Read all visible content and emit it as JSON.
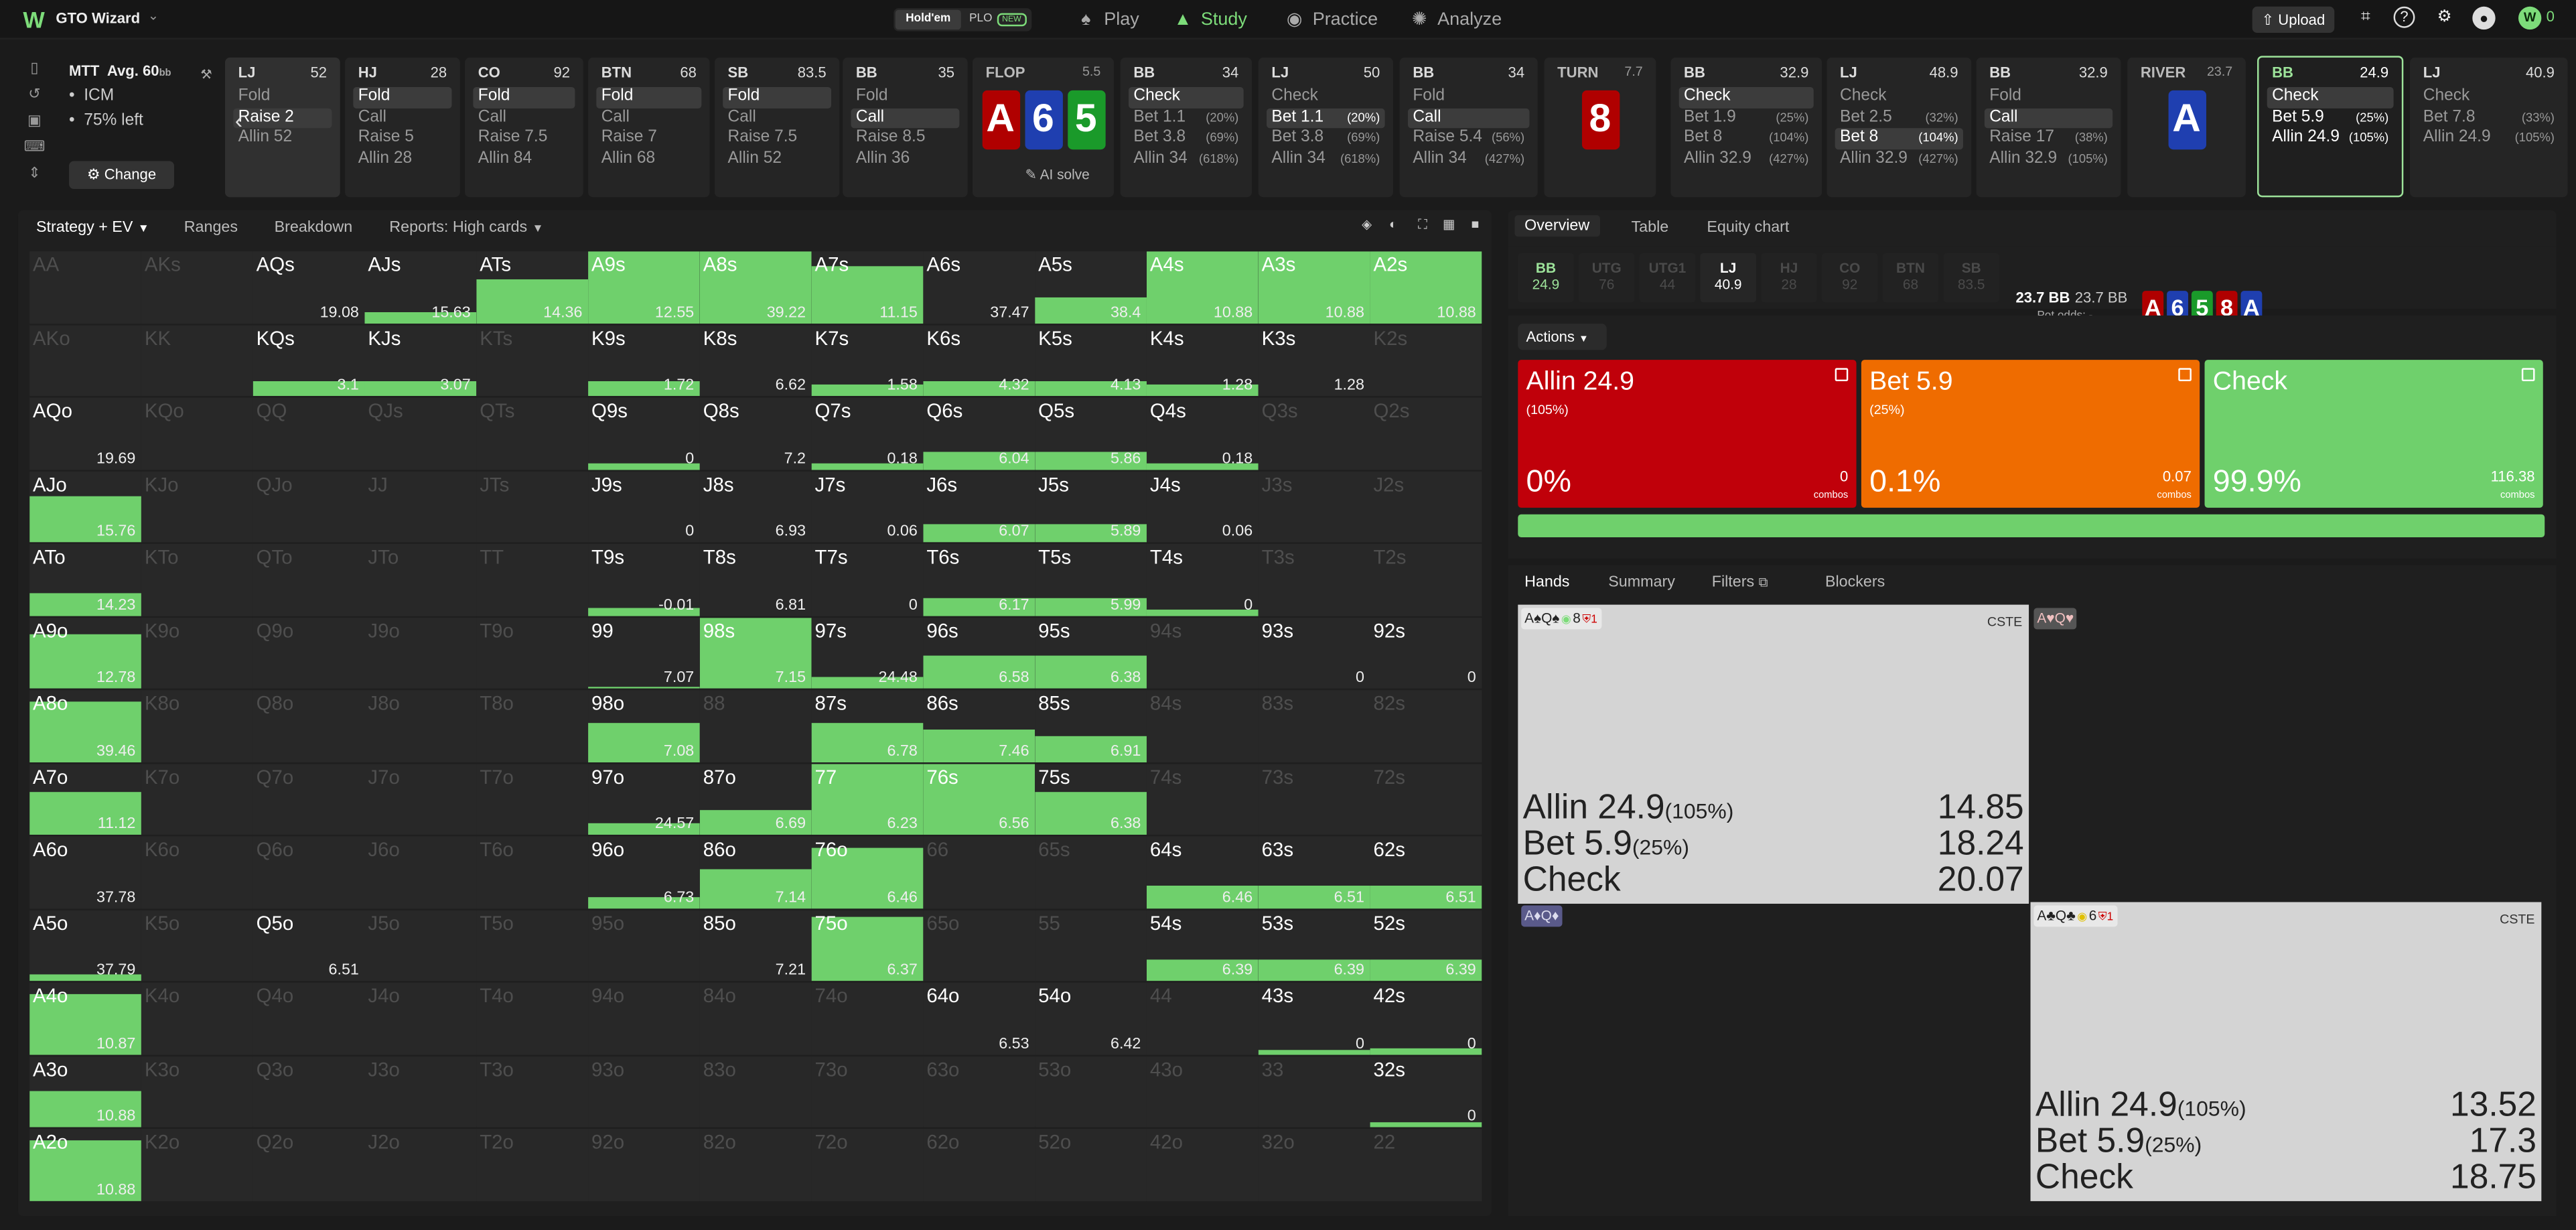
{
  "app": {
    "name": "GTO Wizard",
    "game_holdem": "Hold'em",
    "game_plo": "PLO",
    "game_new": "NEW"
  },
  "nav": [
    {
      "label": "Play",
      "icon": "spade-icon",
      "active": false
    },
    {
      "label": "Study",
      "icon": "graduation-cap-icon",
      "active": true
    },
    {
      "label": "Practice",
      "icon": "gamepad-icon",
      "active": false
    },
    {
      "label": "Analyze",
      "icon": "bulb-icon",
      "active": false
    }
  ],
  "topright": {
    "upload": "Upload",
    "badge_num": "0"
  },
  "mtt": {
    "title": "MTT",
    "avg": "Avg. 60",
    "avg_unit": "bb",
    "icm": "ICM",
    "left": "75% left",
    "change": "Change"
  },
  "positions": [
    {
      "name": "LJ",
      "stack": "52",
      "actions": [
        {
          "t": "Fold"
        },
        {
          "t": "Raise 2",
          "sel": true
        },
        {
          "t": "Allin 52"
        }
      ]
    },
    {
      "name": "HJ",
      "stack": "28",
      "actions": [
        {
          "t": "Fold",
          "sel": true
        },
        {
          "t": "Call"
        },
        {
          "t": "Raise 5"
        },
        {
          "t": "Allin 28"
        }
      ]
    },
    {
      "name": "CO",
      "stack": "92",
      "actions": [
        {
          "t": "Fold",
          "sel": true
        },
        {
          "t": "Call"
        },
        {
          "t": "Raise 7.5"
        },
        {
          "t": "Allin 84"
        }
      ]
    },
    {
      "name": "BTN",
      "stack": "68",
      "actions": [
        {
          "t": "Fold",
          "sel": true
        },
        {
          "t": "Call"
        },
        {
          "t": "Raise 7"
        },
        {
          "t": "Allin 68"
        }
      ]
    },
    {
      "name": "SB",
      "stack": "83.5",
      "actions": [
        {
          "t": "Fold",
          "sel": true
        },
        {
          "t": "Call"
        },
        {
          "t": "Raise 7.5"
        },
        {
          "t": "Allin 52"
        }
      ]
    },
    {
      "name": "BB",
      "stack": "35",
      "actions": [
        {
          "t": "Fold"
        },
        {
          "t": "Call",
          "sel": true
        },
        {
          "t": "Raise 8.5"
        },
        {
          "t": "Allin 36"
        }
      ]
    },
    {
      "name": "FLOP",
      "stack": "5.5",
      "street": true,
      "cards": [
        {
          "r": "A",
          "c": "#b00000"
        },
        {
          "r": "6",
          "c": "#1f3fb0"
        },
        {
          "r": "5",
          "c": "#1a9a2a"
        }
      ],
      "aisolve": "AI solve"
    },
    {
      "name": "BB",
      "stack": "34",
      "actions": [
        {
          "t": "Check",
          "sel": true
        },
        {
          "t": "Bet 1.1",
          "p": "(20%)"
        },
        {
          "t": "Bet 3.8",
          "p": "(69%)"
        },
        {
          "t": "Allin 34",
          "p": "(618%)"
        }
      ]
    },
    {
      "name": "LJ",
      "stack": "50",
      "actions": [
        {
          "t": "Check"
        },
        {
          "t": "Bet 1.1",
          "p": "(20%)",
          "sel": true
        },
        {
          "t": "Bet 3.8",
          "p": "(69%)"
        },
        {
          "t": "Allin 34",
          "p": "(618%)"
        }
      ]
    },
    {
      "name": "BB",
      "stack": "34",
      "actions": [
        {
          "t": "Fold"
        },
        {
          "t": "Call",
          "sel": true
        },
        {
          "t": "Raise 5.4",
          "p": "(56%)"
        },
        {
          "t": "Allin 34",
          "p": "(427%)"
        }
      ]
    },
    {
      "name": "TURN",
      "stack": "7.7",
      "street": true,
      "cards": [
        {
          "r": "8",
          "c": "#b00000"
        }
      ]
    },
    {
      "name": "BB",
      "stack": "32.9",
      "actions": [
        {
          "t": "Check",
          "sel": true
        },
        {
          "t": "Bet 1.9",
          "p": "(25%)"
        },
        {
          "t": "Bet 8",
          "p": "(104%)"
        },
        {
          "t": "Allin 32.9",
          "p": "(427%)"
        }
      ]
    },
    {
      "name": "LJ",
      "stack": "48.9",
      "actions": [
        {
          "t": "Check"
        },
        {
          "t": "Bet 2.5",
          "p": "(32%)"
        },
        {
          "t": "Bet 8",
          "p": "(104%)",
          "sel": true
        },
        {
          "t": "Allin 32.9",
          "p": "(427%)"
        }
      ]
    },
    {
      "name": "BB",
      "stack": "32.9",
      "actions": [
        {
          "t": "Fold"
        },
        {
          "t": "Call",
          "sel": true
        },
        {
          "t": "Raise 17",
          "p": "(38%)"
        },
        {
          "t": "Allin 32.9",
          "p": "(105%)"
        }
      ]
    },
    {
      "name": "RIVER",
      "stack": "23.7",
      "street": true,
      "cards": [
        {
          "r": "A",
          "c": "#1f3fb0"
        }
      ]
    },
    {
      "name": "BB",
      "stack": "24.9",
      "active": true,
      "actions": [
        {
          "t": "Check",
          "sel": true
        },
        {
          "t": "Bet 5.9",
          "p": "(25%)"
        },
        {
          "t": "Allin 24.9",
          "p": "(105%)"
        }
      ]
    },
    {
      "name": "LJ",
      "stack": "40.9",
      "actions": [
        {
          "t": "Check"
        },
        {
          "t": "Bet 7.8",
          "p": "(33%)"
        },
        {
          "t": "Allin 24.9",
          "p": "(105%)"
        }
      ]
    }
  ],
  "left_tabs": {
    "strategy": "Strategy + EV",
    "ranges": "Ranges",
    "breakdown": "Breakdown",
    "reports": "Reports: High cards"
  },
  "grid": [
    [
      {
        "h": "AA",
        "d": 1
      },
      {
        "h": "AKs",
        "d": 1
      },
      {
        "h": "AQs",
        "v": "19.08"
      },
      {
        "h": "AJs",
        "v": "15.63",
        "f": 0.15
      },
      {
        "h": "ATs",
        "v": "14.36",
        "f": 0.6
      },
      {
        "h": "A9s",
        "v": "12.55",
        "f": 1
      },
      {
        "h": "A8s",
        "v": "39.22",
        "f": 1
      },
      {
        "h": "A7s",
        "v": "11.15",
        "f": 0.8
      },
      {
        "h": "A6s",
        "v": "37.47"
      },
      {
        "h": "A5s",
        "v": "38.4",
        "f": 0.35
      },
      {
        "h": "A4s",
        "v": "10.88",
        "f": 1
      },
      {
        "h": "A3s",
        "v": "10.88",
        "f": 1
      },
      {
        "h": "A2s",
        "v": "10.88",
        "f": 1
      }
    ],
    [
      {
        "h": "AKo",
        "d": 1
      },
      {
        "h": "KK",
        "d": 1
      },
      {
        "h": "KQs",
        "v": "3.1",
        "f": 0.2
      },
      {
        "h": "KJs",
        "v": "3.07",
        "f": 0.2
      },
      {
        "h": "KTs",
        "d": 1
      },
      {
        "h": "K9s",
        "v": "1.72",
        "f": 0.2
      },
      {
        "h": "K8s",
        "v": "6.62"
      },
      {
        "h": "K7s",
        "v": "1.58",
        "f": 0.15
      },
      {
        "h": "K6s",
        "v": "4.32",
        "f": 0.2
      },
      {
        "h": "K5s",
        "v": "4.13",
        "f": 0.2
      },
      {
        "h": "K4s",
        "v": "1.28",
        "f": 0.15
      },
      {
        "h": "K3s",
        "v": "1.28"
      },
      {
        "h": "K2s",
        "d": 1
      }
    ],
    [
      {
        "h": "AQo",
        "v": "19.69"
      },
      {
        "h": "KQo",
        "d": 1
      },
      {
        "h": "QQ",
        "d": 1
      },
      {
        "h": "QJs",
        "d": 1
      },
      {
        "h": "QTs",
        "d": 1
      },
      {
        "h": "Q9s",
        "v": "0",
        "f": 0.08
      },
      {
        "h": "Q8s",
        "v": "7.2"
      },
      {
        "h": "Q7s",
        "v": "0.18",
        "f": 0.08
      },
      {
        "h": "Q6s",
        "v": "6.04",
        "f": 0.25
      },
      {
        "h": "Q5s",
        "v": "5.86",
        "f": 0.25
      },
      {
        "h": "Q4s",
        "v": "0.18",
        "f": 0.08
      },
      {
        "h": "Q3s",
        "d": 1
      },
      {
        "h": "Q2s",
        "d": 1
      }
    ],
    [
      {
        "h": "AJo",
        "v": "15.76",
        "f": 0.65
      },
      {
        "h": "KJo",
        "d": 1
      },
      {
        "h": "QJo",
        "d": 1
      },
      {
        "h": "JJ",
        "d": 1
      },
      {
        "h": "JTs",
        "d": 1
      },
      {
        "h": "J9s",
        "v": "0"
      },
      {
        "h": "J8s",
        "v": "6.93"
      },
      {
        "h": "J7s",
        "v": "0.06"
      },
      {
        "h": "J6s",
        "v": "6.07",
        "f": 0.25
      },
      {
        "h": "J5s",
        "v": "5.89",
        "f": 0.25
      },
      {
        "h": "J4s",
        "v": "0.06"
      },
      {
        "h": "J3s",
        "d": 1
      },
      {
        "h": "J2s",
        "d": 1
      }
    ],
    [
      {
        "h": "ATo",
        "v": "14.23",
        "f": 0.3
      },
      {
        "h": "KTo",
        "d": 1
      },
      {
        "h": "QTo",
        "d": 1
      },
      {
        "h": "JTo",
        "d": 1
      },
      {
        "h": "TT",
        "d": 1
      },
      {
        "h": "T9s",
        "v": "-0.01",
        "f": 0.1
      },
      {
        "h": "T8s",
        "v": "6.81"
      },
      {
        "h": "T7s",
        "v": "0"
      },
      {
        "h": "T6s",
        "v": "6.17",
        "f": 0.25
      },
      {
        "h": "T5s",
        "v": "5.99",
        "f": 0.25
      },
      {
        "h": "T4s",
        "v": "0",
        "f": 0.08
      },
      {
        "h": "T3s",
        "d": 1
      },
      {
        "h": "T2s",
        "d": 1
      }
    ],
    [
      {
        "h": "A9o",
        "v": "12.78",
        "f": 0.75
      },
      {
        "h": "K9o",
        "d": 1
      },
      {
        "h": "Q9o",
        "d": 1
      },
      {
        "h": "J9o",
        "d": 1
      },
      {
        "h": "T9o",
        "d": 1
      },
      {
        "h": "99",
        "v": "7.07",
        "f": 0.03
      },
      {
        "h": "98s",
        "v": "7.15",
        "f": 1
      },
      {
        "h": "97s",
        "v": "24.48",
        "f": 0.15
      },
      {
        "h": "96s",
        "v": "6.58",
        "f": 0.45
      },
      {
        "h": "95s",
        "v": "6.38",
        "f": 0.45
      },
      {
        "h": "94s",
        "d": 1
      },
      {
        "h": "93s",
        "v": "0"
      },
      {
        "h": "92s",
        "v": "0"
      }
    ],
    [
      {
        "h": "A8o",
        "v": "39.46",
        "f": 0.85
      },
      {
        "h": "K8o",
        "d": 1
      },
      {
        "h": "Q8o",
        "d": 1
      },
      {
        "h": "J8o",
        "d": 1
      },
      {
        "h": "T8o",
        "d": 1
      },
      {
        "h": "98o",
        "v": "7.08",
        "f": 0.55
      },
      {
        "h": "88",
        "d": 1
      },
      {
        "h": "87s",
        "v": "6.78",
        "f": 0.55
      },
      {
        "h": "86s",
        "v": "7.46",
        "f": 0.45
      },
      {
        "h": "85s",
        "v": "6.91",
        "f": 0.35
      },
      {
        "h": "84s",
        "d": 1
      },
      {
        "h": "83s",
        "d": 1
      },
      {
        "h": "82s",
        "d": 1
      }
    ],
    [
      {
        "h": "A7o",
        "v": "11.12",
        "f": 0.6
      },
      {
        "h": "K7o",
        "d": 1
      },
      {
        "h": "Q7o",
        "d": 1
      },
      {
        "h": "J7o",
        "d": 1
      },
      {
        "h": "T7o",
        "d": 1
      },
      {
        "h": "97o",
        "v": "24.57",
        "f": 0.15
      },
      {
        "h": "87o",
        "v": "6.69",
        "f": 0.35
      },
      {
        "h": "77",
        "v": "6.23",
        "f": 1
      },
      {
        "h": "76s",
        "v": "6.56",
        "f": 1
      },
      {
        "h": "75s",
        "v": "6.38",
        "f": 0.6
      },
      {
        "h": "74s",
        "d": 1
      },
      {
        "h": "73s",
        "d": 1
      },
      {
        "h": "72s",
        "d": 1
      }
    ],
    [
      {
        "h": "A6o",
        "v": "37.78"
      },
      {
        "h": "K6o",
        "d": 1
      },
      {
        "h": "Q6o",
        "d": 1
      },
      {
        "h": "J6o",
        "d": 1
      },
      {
        "h": "T6o",
        "d": 1
      },
      {
        "h": "96o",
        "v": "6.73",
        "f": 0.15
      },
      {
        "h": "86o",
        "v": "7.14",
        "f": 0.55
      },
      {
        "h": "76o",
        "v": "6.46",
        "f": 0.85
      },
      {
        "h": "66",
        "d": 1
      },
      {
        "h": "65s",
        "d": 1
      },
      {
        "h": "64s",
        "v": "6.46",
        "f": 0.3
      },
      {
        "h": "63s",
        "v": "6.51",
        "f": 0.3
      },
      {
        "h": "62s",
        "v": "6.51",
        "f": 0.3
      }
    ],
    [
      {
        "h": "A5o",
        "v": "37.79",
        "f": 0.1
      },
      {
        "h": "K5o",
        "d": 1
      },
      {
        "h": "Q5o",
        "v": "6.51"
      },
      {
        "h": "J5o",
        "d": 1
      },
      {
        "h": "T5o",
        "d": 1
      },
      {
        "h": "95o",
        "d": 1
      },
      {
        "h": "85o",
        "v": "7.21"
      },
      {
        "h": "75o",
        "v": "6.37",
        "f": 0.9
      },
      {
        "h": "65o",
        "d": 1
      },
      {
        "h": "55",
        "d": 1
      },
      {
        "h": "54s",
        "v": "6.39",
        "f": 0.3
      },
      {
        "h": "53s",
        "v": "6.39",
        "f": 0.3
      },
      {
        "h": "52s",
        "v": "6.39",
        "f": 0.3
      }
    ],
    [
      {
        "h": "A4o",
        "v": "10.87",
        "f": 0.85
      },
      {
        "h": "K4o",
        "d": 1
      },
      {
        "h": "Q4o",
        "d": 1
      },
      {
        "h": "J4o",
        "d": 1
      },
      {
        "h": "T4o",
        "d": 1
      },
      {
        "h": "94o",
        "d": 1
      },
      {
        "h": "84o",
        "d": 1
      },
      {
        "h": "74o",
        "d": 1
      },
      {
        "h": "64o",
        "v": "6.53"
      },
      {
        "h": "54o",
        "v": "6.42"
      },
      {
        "h": "44",
        "d": 1
      },
      {
        "h": "43s",
        "v": "0",
        "f": 0.05
      },
      {
        "h": "42s",
        "v": "0",
        "f": 0.08
      }
    ],
    [
      {
        "h": "A3o",
        "v": "10.88",
        "f": 0.5
      },
      {
        "h": "K3o",
        "d": 1
      },
      {
        "h": "Q3o",
        "d": 1
      },
      {
        "h": "J3o",
        "d": 1
      },
      {
        "h": "T3o",
        "d": 1
      },
      {
        "h": "93o",
        "d": 1
      },
      {
        "h": "83o",
        "d": 1
      },
      {
        "h": "73o",
        "d": 1
      },
      {
        "h": "63o",
        "d": 1
      },
      {
        "h": "53o",
        "d": 1
      },
      {
        "h": "43o",
        "d": 1
      },
      {
        "h": "33",
        "d": 1
      },
      {
        "h": "32s",
        "v": "0",
        "f": 0.08
      }
    ],
    [
      {
        "h": "A2o",
        "v": "10.88",
        "f": 0.85
      },
      {
        "h": "K2o",
        "d": 1
      },
      {
        "h": "Q2o",
        "d": 1
      },
      {
        "h": "J2o",
        "d": 1
      },
      {
        "h": "T2o",
        "d": 1
      },
      {
        "h": "92o",
        "d": 1
      },
      {
        "h": "82o",
        "d": 1
      },
      {
        "h": "72o",
        "d": 1
      },
      {
        "h": "62o",
        "d": 1
      },
      {
        "h": "52o",
        "d": 1
      },
      {
        "h": "42o",
        "d": 1
      },
      {
        "h": "32o",
        "d": 1
      },
      {
        "h": "22",
        "d": 1
      }
    ]
  ],
  "right_tabs": {
    "overview": "Overview",
    "table": "Table",
    "equity": "Equity chart"
  },
  "seats": [
    {
      "n": "BB",
      "s": "24.9",
      "state": "green"
    },
    {
      "n": "UTG",
      "s": "76",
      "state": "dim"
    },
    {
      "n": "UTG1",
      "s": "44",
      "state": "dim"
    },
    {
      "n": "LJ",
      "s": "40.9",
      "state": "white"
    },
    {
      "n": "HJ",
      "s": "28",
      "state": "dim"
    },
    {
      "n": "CO",
      "s": "92",
      "state": "dim"
    },
    {
      "n": "BTN",
      "s": "68",
      "state": "dim"
    },
    {
      "n": "SB",
      "s": "83.5",
      "state": "dim"
    }
  ],
  "pot": {
    "main": "23.7 BB",
    "second": "23.7 BB",
    "odds_label": "Pot odds:",
    "odds": "-"
  },
  "board": [
    {
      "r": "A",
      "c": "#b00000"
    },
    {
      "r": "6",
      "c": "#1f3fb0"
    },
    {
      "r": "5",
      "c": "#1a9a2a"
    },
    {
      "r": "8",
      "c": "#b00000"
    },
    {
      "r": "A",
      "c": "#1f3fb0"
    }
  ],
  "actions_label": "Actions",
  "action_boxes": [
    {
      "name": "Allin 24.9",
      "pct": "(105%)",
      "freq": "0%",
      "combos": "0",
      "combos_label": "combos",
      "color": "#c0000a"
    },
    {
      "name": "Bet 5.9",
      "pct": "(25%)",
      "freq": "0.1%",
      "combos": "0.07",
      "combos_label": "combos",
      "color": "#ef6c00"
    },
    {
      "name": "Check",
      "pct": "",
      "freq": "99.9%",
      "combos": "116.38",
      "combos_label": "combos",
      "color": "#6fd06c"
    }
  ],
  "hand_tabs": {
    "hands": "Hands",
    "summary": "Summary",
    "filters": "Filters",
    "blockers": "Blockers"
  },
  "hand_cards": [
    {
      "combo": "A♠Q♠",
      "extra": "8",
      "cste": "CSTE",
      "light": true,
      "rows": [
        {
          "a": "Allin 24.9",
          "p": "(105%)",
          "v": "14.85"
        },
        {
          "a": "Bet 5.9",
          "p": "(25%)",
          "v": "18.24"
        },
        {
          "a": "Check",
          "p": "",
          "v": "20.07"
        }
      ]
    },
    {
      "combo": "A♥Q♥",
      "light": false
    },
    {
      "combo": "A♦Q♦",
      "light": false
    },
    {
      "combo": "A♣Q♣",
      "extra": "6",
      "cste": "CSTE",
      "light": true,
      "rows": [
        {
          "a": "Allin 24.9",
          "p": "(105%)",
          "v": "13.52"
        },
        {
          "a": "Bet 5.9",
          "p": "(25%)",
          "v": "17.3"
        },
        {
          "a": "Check",
          "p": "",
          "v": "18.75"
        }
      ]
    }
  ]
}
